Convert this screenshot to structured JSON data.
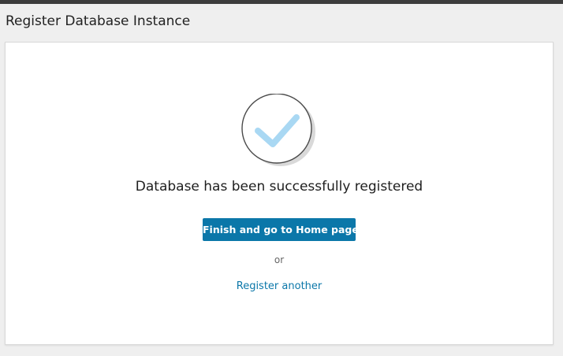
{
  "header": {
    "title": "Register Database Instance"
  },
  "result": {
    "icon": "checkmark-circle-icon",
    "message": "Database has been successfully registered"
  },
  "actions": {
    "finish_label": "Finish and go to Home page",
    "separator": "or",
    "register_another_label": "Register another"
  },
  "colors": {
    "accent": "#0b77a9",
    "check": "#a9d8f3",
    "top_bar": "#3c3c3c"
  }
}
